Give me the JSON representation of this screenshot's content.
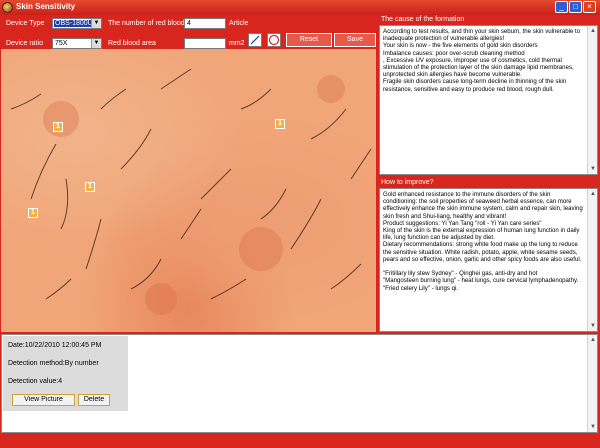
{
  "window": {
    "title": "Skin Sensitivity"
  },
  "toolbar": {
    "device_type_label": "Device Type",
    "device_type_value": "OBS-1800UI",
    "device_ratio_label": "Device ratio",
    "device_ratio_value": "75X",
    "red_blood_count_label": "The number of red blood",
    "red_blood_count_value": "4",
    "red_blood_count_unit": "Article",
    "red_blood_area_label": "Red blood area",
    "red_blood_area_value": "",
    "red_blood_area_unit": "mm2",
    "reset_label": "Reset",
    "save_label": "Save"
  },
  "markers": [
    "1",
    "1",
    "1",
    "1"
  ],
  "cause_panel": {
    "title": "The cause of the formation",
    "text": "According to test results, and thin your skin sebum, the skin vulnerable to inadequate protection of vulnerable allergies!\nYour skin is now - the five elements of gold skin disorders\nImbalance causes: poor over-scrub cleaning method\n, Excessive UV exposure, improper use of cosmetics, cold thermal stimulation of the protection layer of the skin damage lipid membranes, unprotected skin allergies have become vulnerable.\nFragile skin disorders cause long-term decline in thinning of the skin resistance, sensitive and easy to produce red blood, rough dull."
  },
  "improve_panel": {
    "title": "How to improve?",
    "text": " Gold enhanced resistance to the immune disorders of the skin conditioning: the soil properties of seaweed herbal essence, can more effectively enhance the skin immune system, calm and repair skin, leaving skin fresh and Shui-liang, healthy and vibrant!\nProduct suggestions: Yi Yan Tang \"roll - Yi Yan care series\"\nKing of the skin is the external expression of human lung function in daily life, lung function can be adjusted by diet.\nDietary recommendations: strong white food make up the lung to reduce the sensitive situation. White radish, potato, apple, white sesame seeds, pears and so effective, onion, garlic and other spicy foods are also useful.\n\n\"Fritillary lily stew Sydney\" - Qinghei gas, anti-dry and hot\n\"Mangosteen burning lung\" - heat lungs, cure cervical lymphadenopathy.\n\"Fried celery Lily\" - lungs qi."
  },
  "record": {
    "date": "Date:10/22/2010 12:00:45 PM",
    "method": "Detection method:By number",
    "value": "Detection value:4",
    "view_picture_label": "View Picture",
    "delete_label": "Delete"
  },
  "colors": {
    "frame": "#d8261f",
    "marker": "#f4b14a",
    "skin": "#f0a679"
  }
}
